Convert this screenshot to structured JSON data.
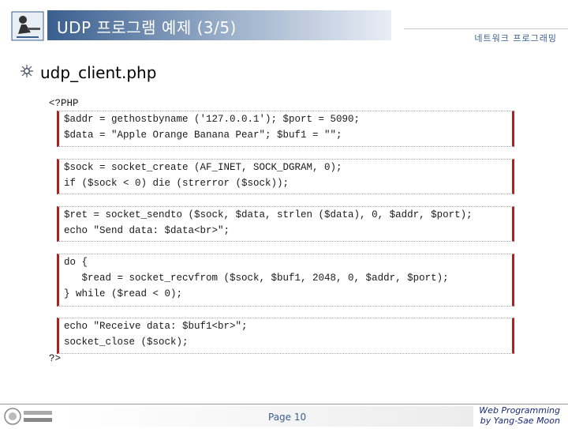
{
  "header": {
    "title": "UDP 프로그램 예제 (3/5)",
    "subtitle": "네트워크 프로그래밍"
  },
  "section": {
    "title": "udp_client.php"
  },
  "code": {
    "open_tag": "<?PHP",
    "close_tag": "?>",
    "blocks": [
      {
        "lines": [
          "$addr = gethostbyname ('127.0.0.1'); $port = 5090;",
          "$data = \"Apple Orange Banana Pear\"; $buf1 = \"\";"
        ]
      },
      {
        "lines": [
          "$sock = socket_create (AF_INET, SOCK_DGRAM, 0);",
          "if ($sock < 0) die (strerror ($sock));"
        ]
      },
      {
        "lines": [
          "$ret = socket_sendto ($sock, $data, strlen ($data), 0, $addr, $port);",
          "echo \"Send data: $data<br>\";"
        ]
      },
      {
        "lines": [
          "do {",
          "   $read = socket_recvfrom ($sock, $buf1, 2048, 0, $addr, $port);",
          "} while ($read < 0);"
        ]
      },
      {
        "lines": [
          "echo \"Receive data: $buf1<br>\";",
          "socket_close ($sock);"
        ]
      }
    ]
  },
  "footer": {
    "page": "Page 10",
    "credit_line1": "Web Programming",
    "credit_line2": "by Yang-Sae Moon"
  }
}
